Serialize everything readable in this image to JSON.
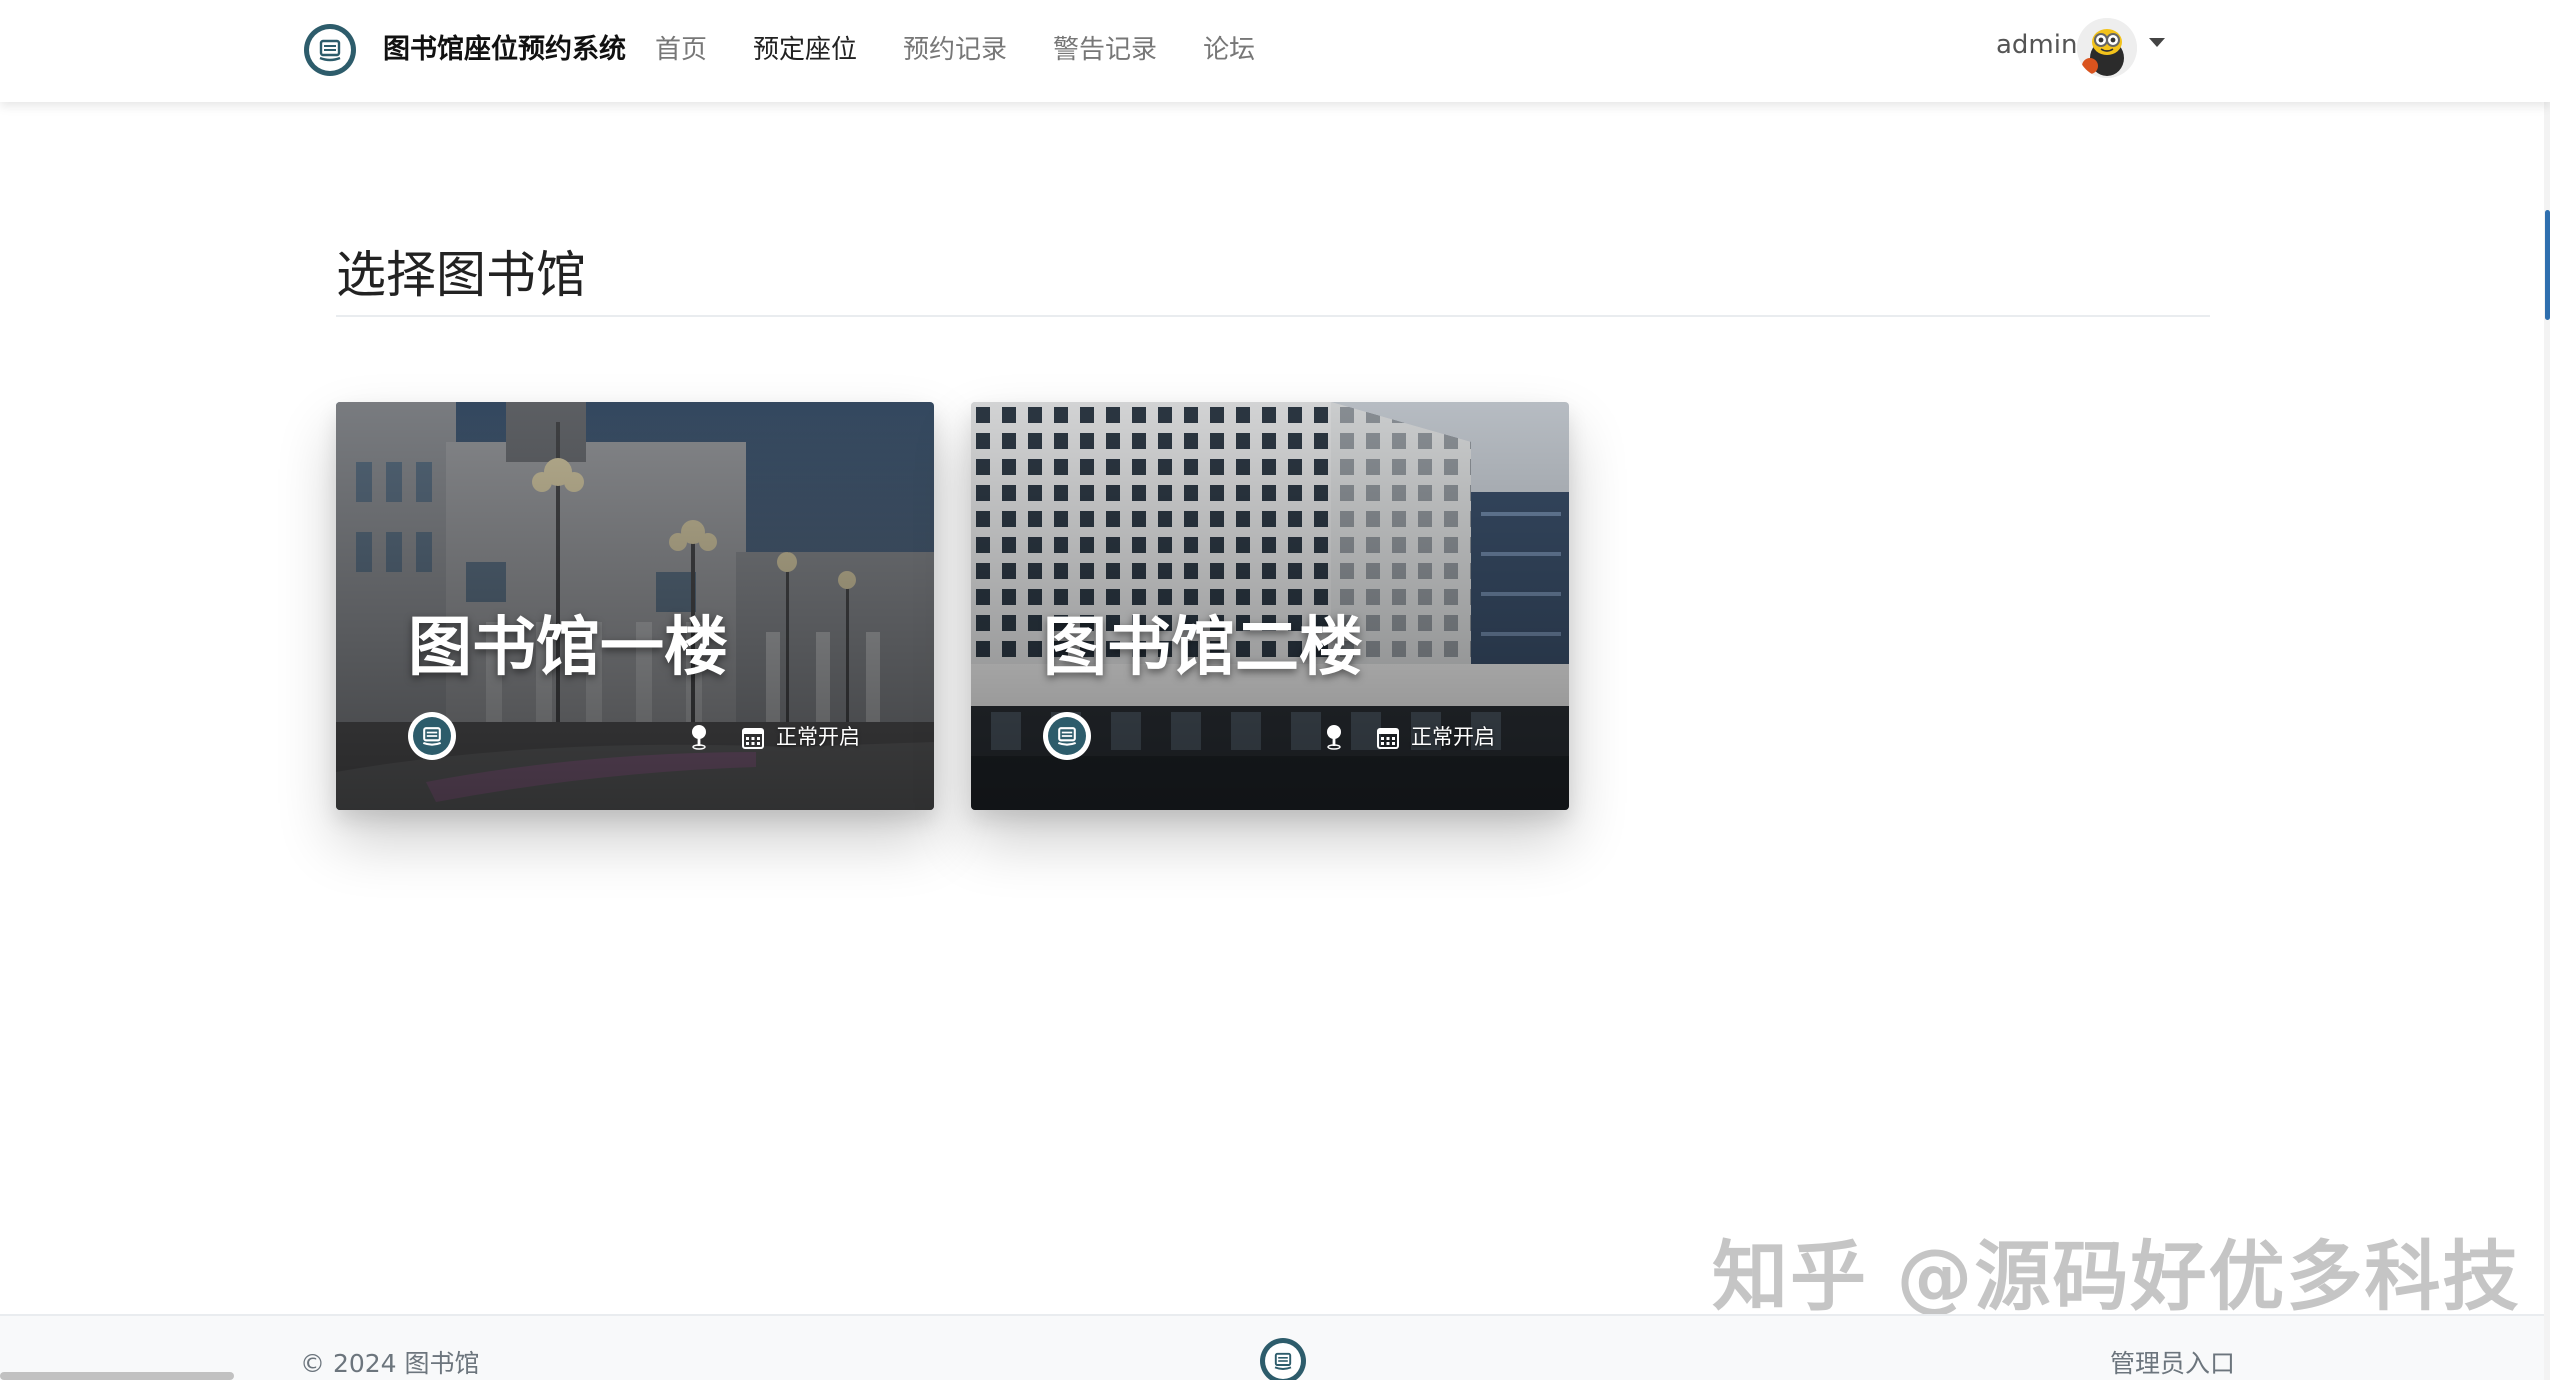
{
  "navbar": {
    "brand_icon": "library-logo-icon",
    "brand_title": "图书馆座位预约系统",
    "links": [
      {
        "label": "首页",
        "active": false
      },
      {
        "label": "预定座位",
        "active": true
      },
      {
        "label": "预约记录",
        "active": false
      },
      {
        "label": "警告记录",
        "active": false
      },
      {
        "label": "论坛",
        "active": false
      }
    ],
    "user": {
      "name": "admin",
      "avatar_icon": "avatar-icon",
      "caret_icon": "caret-down-icon"
    }
  },
  "main": {
    "title": "选择图书馆",
    "libraries": [
      {
        "name": "图书馆一楼",
        "status": "正常开启",
        "logo_icon": "library-logo-icon",
        "location_icon": "map-pin-icon",
        "calendar_icon": "calendar-icon"
      },
      {
        "name": "图书馆二楼",
        "status": "正常开启",
        "logo_icon": "library-logo-icon",
        "location_icon": "map-pin-icon",
        "calendar_icon": "calendar-icon"
      }
    ]
  },
  "watermark": "知乎 @源码好优多科技",
  "footer": {
    "copyright": "© 2024 图书馆",
    "logo_icon": "library-logo-icon",
    "admin_link": "管理员入口"
  },
  "colors": {
    "brand": "#2d5c6b",
    "nav_text": "#777777",
    "nav_active": "#222222",
    "footer_bg": "#f8f9fa"
  }
}
